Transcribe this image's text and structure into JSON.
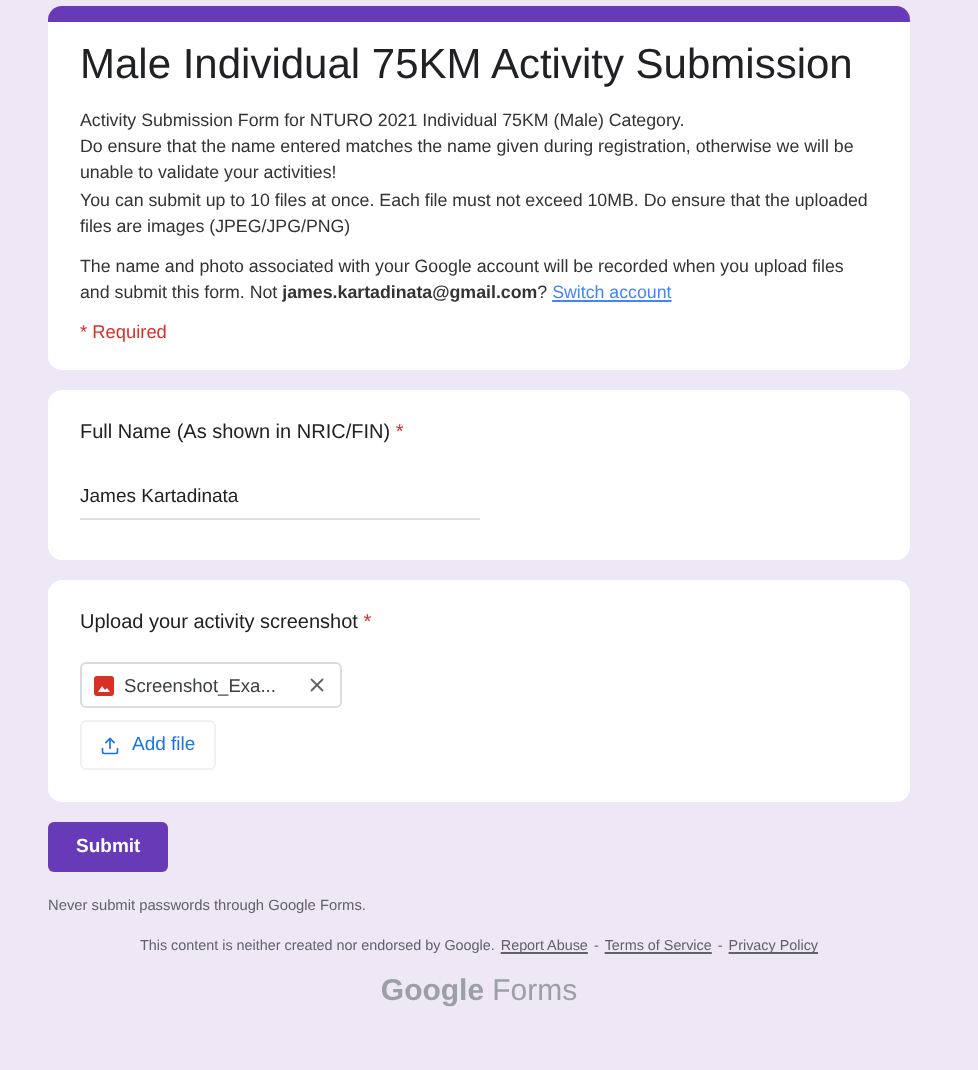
{
  "header": {
    "title": "Male Individual 75KM Activity Submission",
    "description": [
      "Activity Submission Form for NTURO 2021 Individual 75KM (Male) Category.",
      "Do ensure that the name entered matches the name given during registration, otherwise we will be unable to validate your activities!",
      "You can submit up to 10 files at once. Each file must not exceed 10MB. Do ensure that the uploaded files are images (JPEG/JPG/PNG)"
    ],
    "account_notice": "The name and photo associated with your Google account will be recorded when you upload files and submit this form. Not **james.kartadinata@gmail.com**?",
    "switch_link": "Switch account",
    "required_note": "* Required"
  },
  "required_mark": "*",
  "questions": [
    {
      "kind": "text",
      "label": "Full Name (As shown in NRIC/FIN)",
      "required": true,
      "value": "James Kartadinata"
    },
    {
      "kind": "file",
      "label": "Upload your activity screenshot",
      "required": true,
      "files": [
        {
          "name": "Screenshot_Exa..."
        }
      ],
      "add_button": "Add file"
    }
  ],
  "submit": "Submit",
  "footer": {
    "warning": "Never submit passwords through Google Forms.",
    "disclaimer": "This content is neither created nor endorsed by Google.",
    "links": [
      "Report Abuse",
      "Terms of Service",
      "Privacy Policy"
    ],
    "link_separator": "-",
    "logo_brand": "Google",
    "logo_product": "Forms"
  }
}
